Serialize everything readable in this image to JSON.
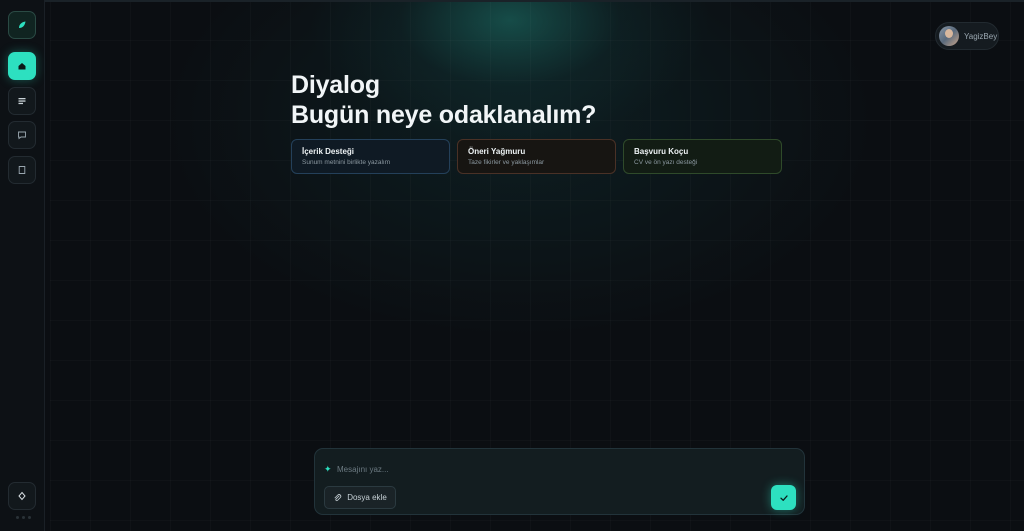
{
  "app": {
    "title": "Diyalog",
    "subtitle": "Bugün neye odaklanalım?"
  },
  "user": {
    "name": "YagizBey"
  },
  "sidebar": {
    "items": [
      {
        "icon": "leaf-icon",
        "active": false
      },
      {
        "icon": "home-icon",
        "active": true
      },
      {
        "icon": "list-icon",
        "active": false
      },
      {
        "icon": "chat-icon",
        "active": false
      },
      {
        "icon": "book-icon",
        "active": false
      }
    ],
    "bottom_icon": "diamond-icon"
  },
  "cards": [
    {
      "title": "İçerik Desteği",
      "subtitle": "Sunum metnini birlikte yazalım",
      "color": "#24405a"
    },
    {
      "title": "Öneri Yağmuru",
      "subtitle": "Taze fikirler ve yaklaşımlar",
      "color": "#4a3126"
    },
    {
      "title": "Başvuru Koçu",
      "subtitle": "CV ve ön yazı desteği",
      "color": "#2f4a2a"
    }
  ],
  "composer": {
    "placeholder": "Mesajını yaz...",
    "attach_label": "Dosya ekle"
  },
  "colors": {
    "accent": "#2de0c0",
    "background": "#0b0e12"
  }
}
